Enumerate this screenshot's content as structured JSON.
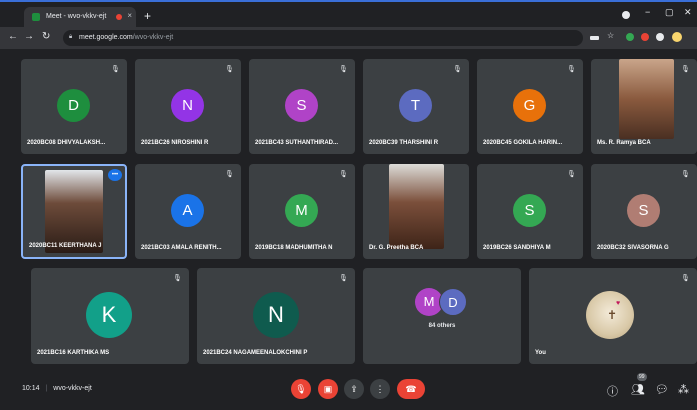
{
  "browser": {
    "tab_title": "Meet - wvo-vkkv-ejt",
    "tab_close": "×",
    "new_tab": "+",
    "win_min": "−",
    "win_max": "▢",
    "win_close": "✕",
    "url_host": "meet.google.com",
    "url_path": "/wvo-vkkv-ejt"
  },
  "colors": {
    "green_d": "#1e8e3e",
    "purple": "#9334e6",
    "pink": "#b043c7",
    "indigo": "#5c6bc0",
    "orange": "#e8710a",
    "blue": "#1a73e8",
    "green": "#34a853",
    "teal": "#12a089",
    "dark_teal": "#0f5b4e",
    "brown": "#b07d73",
    "red": "#ea4335"
  },
  "participants": {
    "p1": {
      "initial": "D",
      "name": "2020BC08 DHIVYALAKSH..."
    },
    "p2": {
      "initial": "N",
      "name": "2021BC26 NIROSHINI R"
    },
    "p3": {
      "initial": "S",
      "name": "2021BC43 SUTHANTHIRAD..."
    },
    "p4": {
      "initial": "T",
      "name": "2020BC39 THARSHINI R"
    },
    "p5": {
      "initial": "G",
      "name": "2020BC45 GOKILA HARIN..."
    },
    "p6": {
      "name": "Ms. R. Ramya BCA"
    },
    "p7": {
      "name": "2020BC11 KEERTHANA J"
    },
    "p8": {
      "initial": "A",
      "name": "2021BC03 AMALA RENITH..."
    },
    "p9": {
      "initial": "M",
      "name": "2019BC18 MADHUMITHA N"
    },
    "p10": {
      "name": "Dr. G. Preetha BCA"
    },
    "p11": {
      "initial": "S",
      "name": "2019BC26 SANDHIYA M"
    },
    "p12": {
      "initial": "S",
      "name": "2020BC32 SIVASORNA G"
    },
    "p13": {
      "initial": "K",
      "name": "2021BC16 KARTHIKA MS"
    },
    "p14": {
      "initial": "N",
      "name": "2021BC24 NAGAMEENALOKCHINI P"
    },
    "others": {
      "initial_a": "M",
      "initial_b": "D",
      "label": "84 others"
    },
    "you": {
      "name": "You"
    }
  },
  "meeting": {
    "time": "10:14",
    "separator": "|",
    "code": "wvo-vkkv-ejt"
  },
  "icons": {
    "mic_off": "mic-off-icon",
    "cam_off": "camera-off-icon",
    "present": "present-icon",
    "more": "more-vert-icon",
    "hangup": "call-end-icon",
    "info": "info-icon",
    "people": "people-icon",
    "chat": "chat-icon",
    "activities": "activities-icon"
  },
  "people_count": "99"
}
